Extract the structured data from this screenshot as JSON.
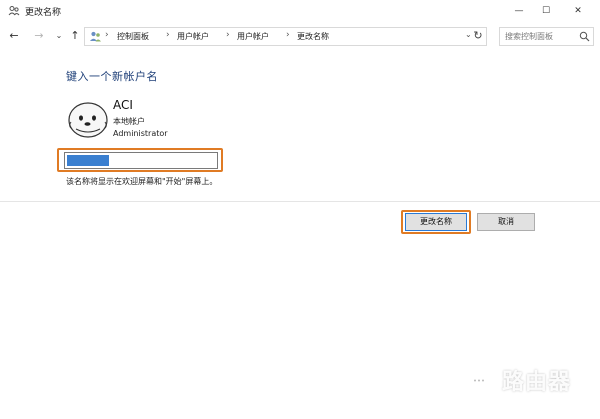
{
  "window": {
    "title": "更改名称",
    "title_icon": "users-icon",
    "controls": {
      "minimize": "—",
      "maximize": "☐",
      "close": "✕"
    }
  },
  "nav": {
    "back": "←",
    "forward": "→",
    "recent": "⌄",
    "up": "↑",
    "breadcrumbs": [
      "控制面板",
      "用户帐户",
      "用户帐户",
      "更改名称"
    ],
    "dropdown": "⌄",
    "refresh": "↻",
    "search_placeholder": "搜索控制面板"
  },
  "content": {
    "heading": "键入一个新帐户名",
    "account": {
      "name": "ACI",
      "type": "本地帐户",
      "role": "Administrator"
    },
    "new_name_value": "",
    "hint": "该名称将显示在欢迎屏幕和\"开始\"屏幕上。"
  },
  "buttons": {
    "ok": "更改名称",
    "cancel": "取消"
  },
  "watermark": {
    "text": "路由器"
  },
  "colors": {
    "accent_highlight": "#e07b24",
    "heading": "#1e3f78",
    "selection": "#3a7fd0"
  }
}
